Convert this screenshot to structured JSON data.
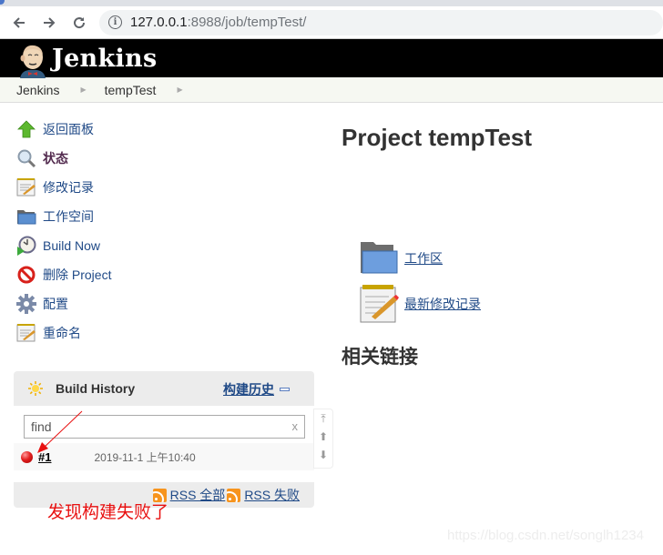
{
  "browser": {
    "url_host": "127.0.0.1",
    "url_rest": ":8988/job/tempTest/",
    "back_icon": "arrow-left-icon",
    "forward_icon": "arrow-right-icon",
    "reload_icon": "reload-icon",
    "info_icon": "info-icon"
  },
  "header": {
    "brand": "Jenkins"
  },
  "breadcrumbs": [
    {
      "label": "Jenkins"
    },
    {
      "label": "tempTest"
    }
  ],
  "sidebar": {
    "items": [
      {
        "label": "返回面板",
        "icon": "up-arrow-icon"
      },
      {
        "label": "状态",
        "icon": "search-icon",
        "current": true
      },
      {
        "label": "修改记录",
        "icon": "notepad-icon"
      },
      {
        "label": "工作空间",
        "icon": "folder-icon"
      },
      {
        "label": "Build Now",
        "icon": "clock-play-icon"
      },
      {
        "label": "删除 Project",
        "icon": "no-entry-icon"
      },
      {
        "label": "配置",
        "icon": "gear-icon"
      },
      {
        "label": "重命名",
        "icon": "notepad-icon"
      }
    ]
  },
  "build_history": {
    "title": "Build History",
    "trend_link": "构建历史",
    "find_placeholder": "find",
    "clear_label": "x",
    "builds": [
      {
        "number": "#1",
        "date": "2019-11-1 上午10:40",
        "status": "failed",
        "status_color": "#e32020"
      }
    ],
    "rss_all": "RSS 全部",
    "rss_failed": "RSS 失败"
  },
  "annotation": "发现构建失败了",
  "main": {
    "title": "Project tempTest",
    "links": [
      {
        "label": "工作区",
        "icon": "folder-icon"
      },
      {
        "label": "最新修改记录",
        "icon": "notepad-icon"
      }
    ],
    "related_heading": "相关链接"
  },
  "watermark": "https://blog.csdn.net/songlh1234",
  "colors": {
    "link": "#204a87",
    "header_bg": "#000000",
    "breadcrumb_bg": "#f6f8f2",
    "annotation": "#e81010"
  }
}
